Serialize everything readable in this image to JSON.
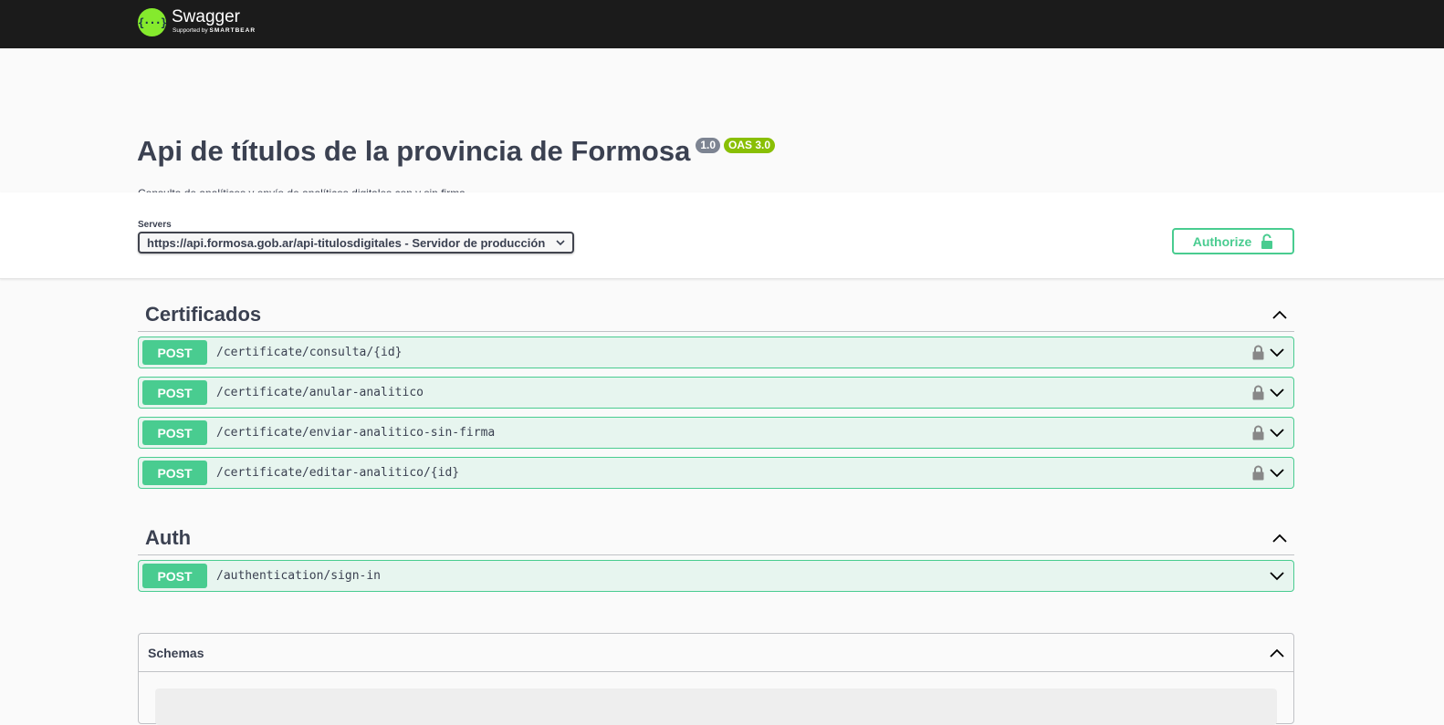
{
  "topbar": {
    "logo_glyph": "{···}",
    "brand_name": "Swagger",
    "brand_sub_prefix": "Supported by ",
    "brand_sub_company": "SMARTBEAR"
  },
  "info": {
    "title": "Api de títulos de la provincia de Formosa",
    "version": "1.0",
    "oas": "OAS 3.0",
    "description": "Consulta de analíticos y envío de analíticos digitales con y sin firma."
  },
  "servers": {
    "label": "Servers",
    "selected": "https://api.formosa.gob.ar/api-titulosdigitales - Servidor de producción"
  },
  "authorize": {
    "label": "Authorize"
  },
  "tags": [
    {
      "name": "Certificados",
      "operations": [
        {
          "method": "POST",
          "path": "/certificate/consulta/{id}",
          "locked": true
        },
        {
          "method": "POST",
          "path": "/certificate/anular-analitico",
          "locked": true
        },
        {
          "method": "POST",
          "path": "/certificate/enviar-analitico-sin-firma",
          "locked": true
        },
        {
          "method": "POST",
          "path": "/certificate/editar-analitico/{id}",
          "locked": true
        }
      ]
    },
    {
      "name": "Auth",
      "operations": [
        {
          "method": "POST",
          "path": "/authentication/sign-in",
          "locked": false
        }
      ]
    }
  ],
  "schemas": {
    "title": "Schemas"
  },
  "colors": {
    "post": "#49cc90",
    "topbar": "#1b1b1b",
    "version_badge": "#7d8492",
    "oas_badge": "#89bf04"
  }
}
